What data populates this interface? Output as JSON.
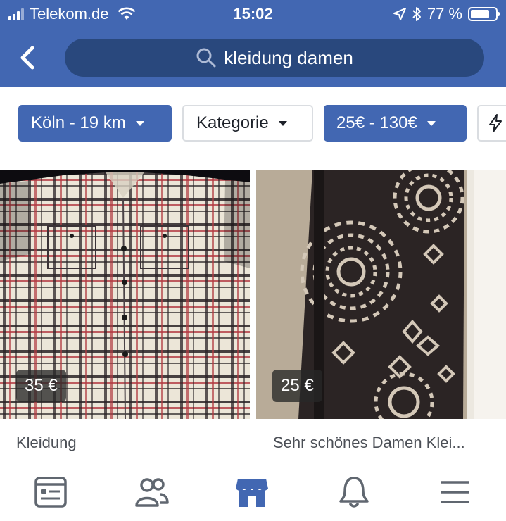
{
  "status_bar": {
    "carrier": "Telekom.de",
    "time": "15:02",
    "battery": "77 %",
    "battery_level": 0.77
  },
  "header": {
    "back_icon": "back-arrow-icon",
    "search_query": "kleidung damen",
    "search_icon": "search-icon"
  },
  "filters": [
    {
      "label": "Köln - 19 km",
      "active": true
    },
    {
      "label": "Kategorie",
      "active": false
    },
    {
      "label": "25€ - 130€",
      "active": true
    }
  ],
  "listings": [
    {
      "price": "35 €",
      "title": "Kleidung"
    },
    {
      "price": "25 €",
      "title": "Sehr schönes Damen Klei..."
    }
  ],
  "tab_bar": {
    "items": [
      "news-feed-icon",
      "friends-icon",
      "marketplace-icon",
      "notifications-icon",
      "menu-icon"
    ],
    "active": "marketplace-icon"
  },
  "colors": {
    "brand": "#4267b2",
    "search_bg": "#29487d",
    "icon_gray": "#606770"
  }
}
